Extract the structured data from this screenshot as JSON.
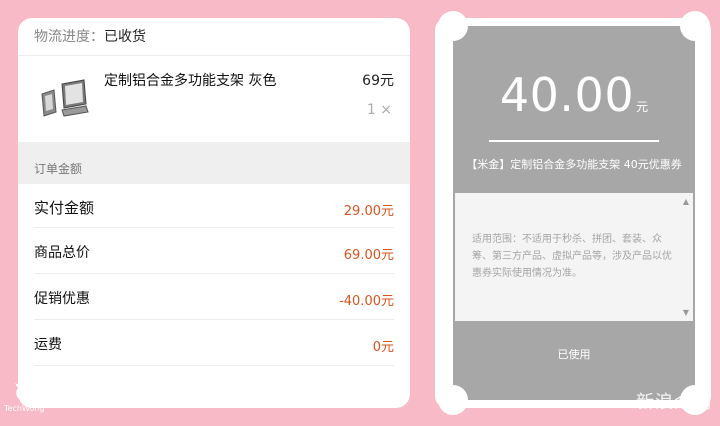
{
  "order": {
    "logistics_label": "物流进度：",
    "logistics_status": "已收货",
    "product": {
      "name": "定制铝合金多功能支架 灰色",
      "price": "69元",
      "qty": "1 ×",
      "thumb_icon": "laptop-stand-icon"
    },
    "section_title": "订单金额",
    "summary": [
      {
        "label": "实付金额",
        "value": "29.00元"
      },
      {
        "label": "商品总价",
        "value": "69.00元"
      },
      {
        "label": "促销优惠",
        "value": "-40.00元"
      },
      {
        "label": "运费",
        "value": "0元"
      }
    ]
  },
  "coupon": {
    "amount": "40.00",
    "unit": "元",
    "title": "【米金】定制铝合金多功能支架 40元优惠券",
    "terms": "适用范围：不适用于秒杀、拼团、套装、众筹、第三方产品、虚拟产品等，涉及产品以优惠券实际使用情况为准。",
    "status": "已使用"
  },
  "watermark": {
    "left": "TechWong",
    "right": "新浪众测"
  },
  "colors": {
    "background": "#f8bac6",
    "accent": "#d9541e",
    "ticket": "#a7a7a7"
  }
}
